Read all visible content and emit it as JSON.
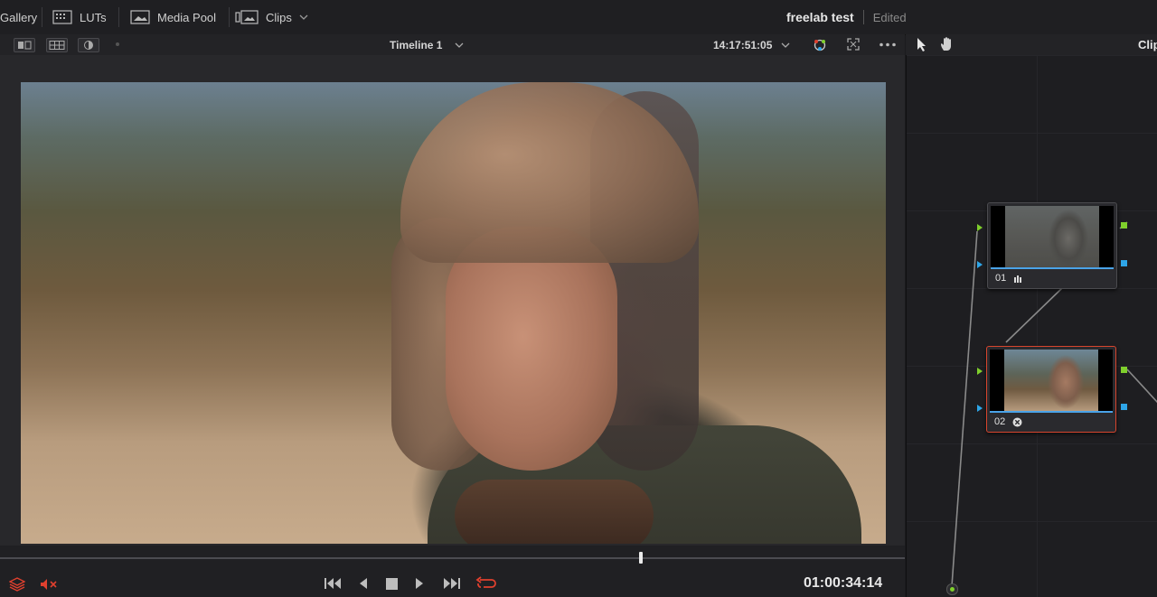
{
  "topbar": {
    "gallery": "Gallery",
    "luts": "LUTs",
    "media_pool": "Media Pool",
    "clips": "Clips",
    "project_name": "freelab test",
    "project_status": "Edited"
  },
  "viewer": {
    "timeline_name": "Timeline 1",
    "timecode": "14:17:51:05"
  },
  "node_panel": {
    "clip_label": "Clip"
  },
  "nodes": [
    {
      "label": "01",
      "badge": "bars-icon"
    },
    {
      "label": "02",
      "badge": "circle-x-icon"
    }
  ],
  "transport": {
    "timecode": "01:00:34:14"
  },
  "colors": {
    "accent_red": "#e0402e",
    "node_green": "#7fcf2c",
    "node_blue": "#2ea6e8"
  }
}
